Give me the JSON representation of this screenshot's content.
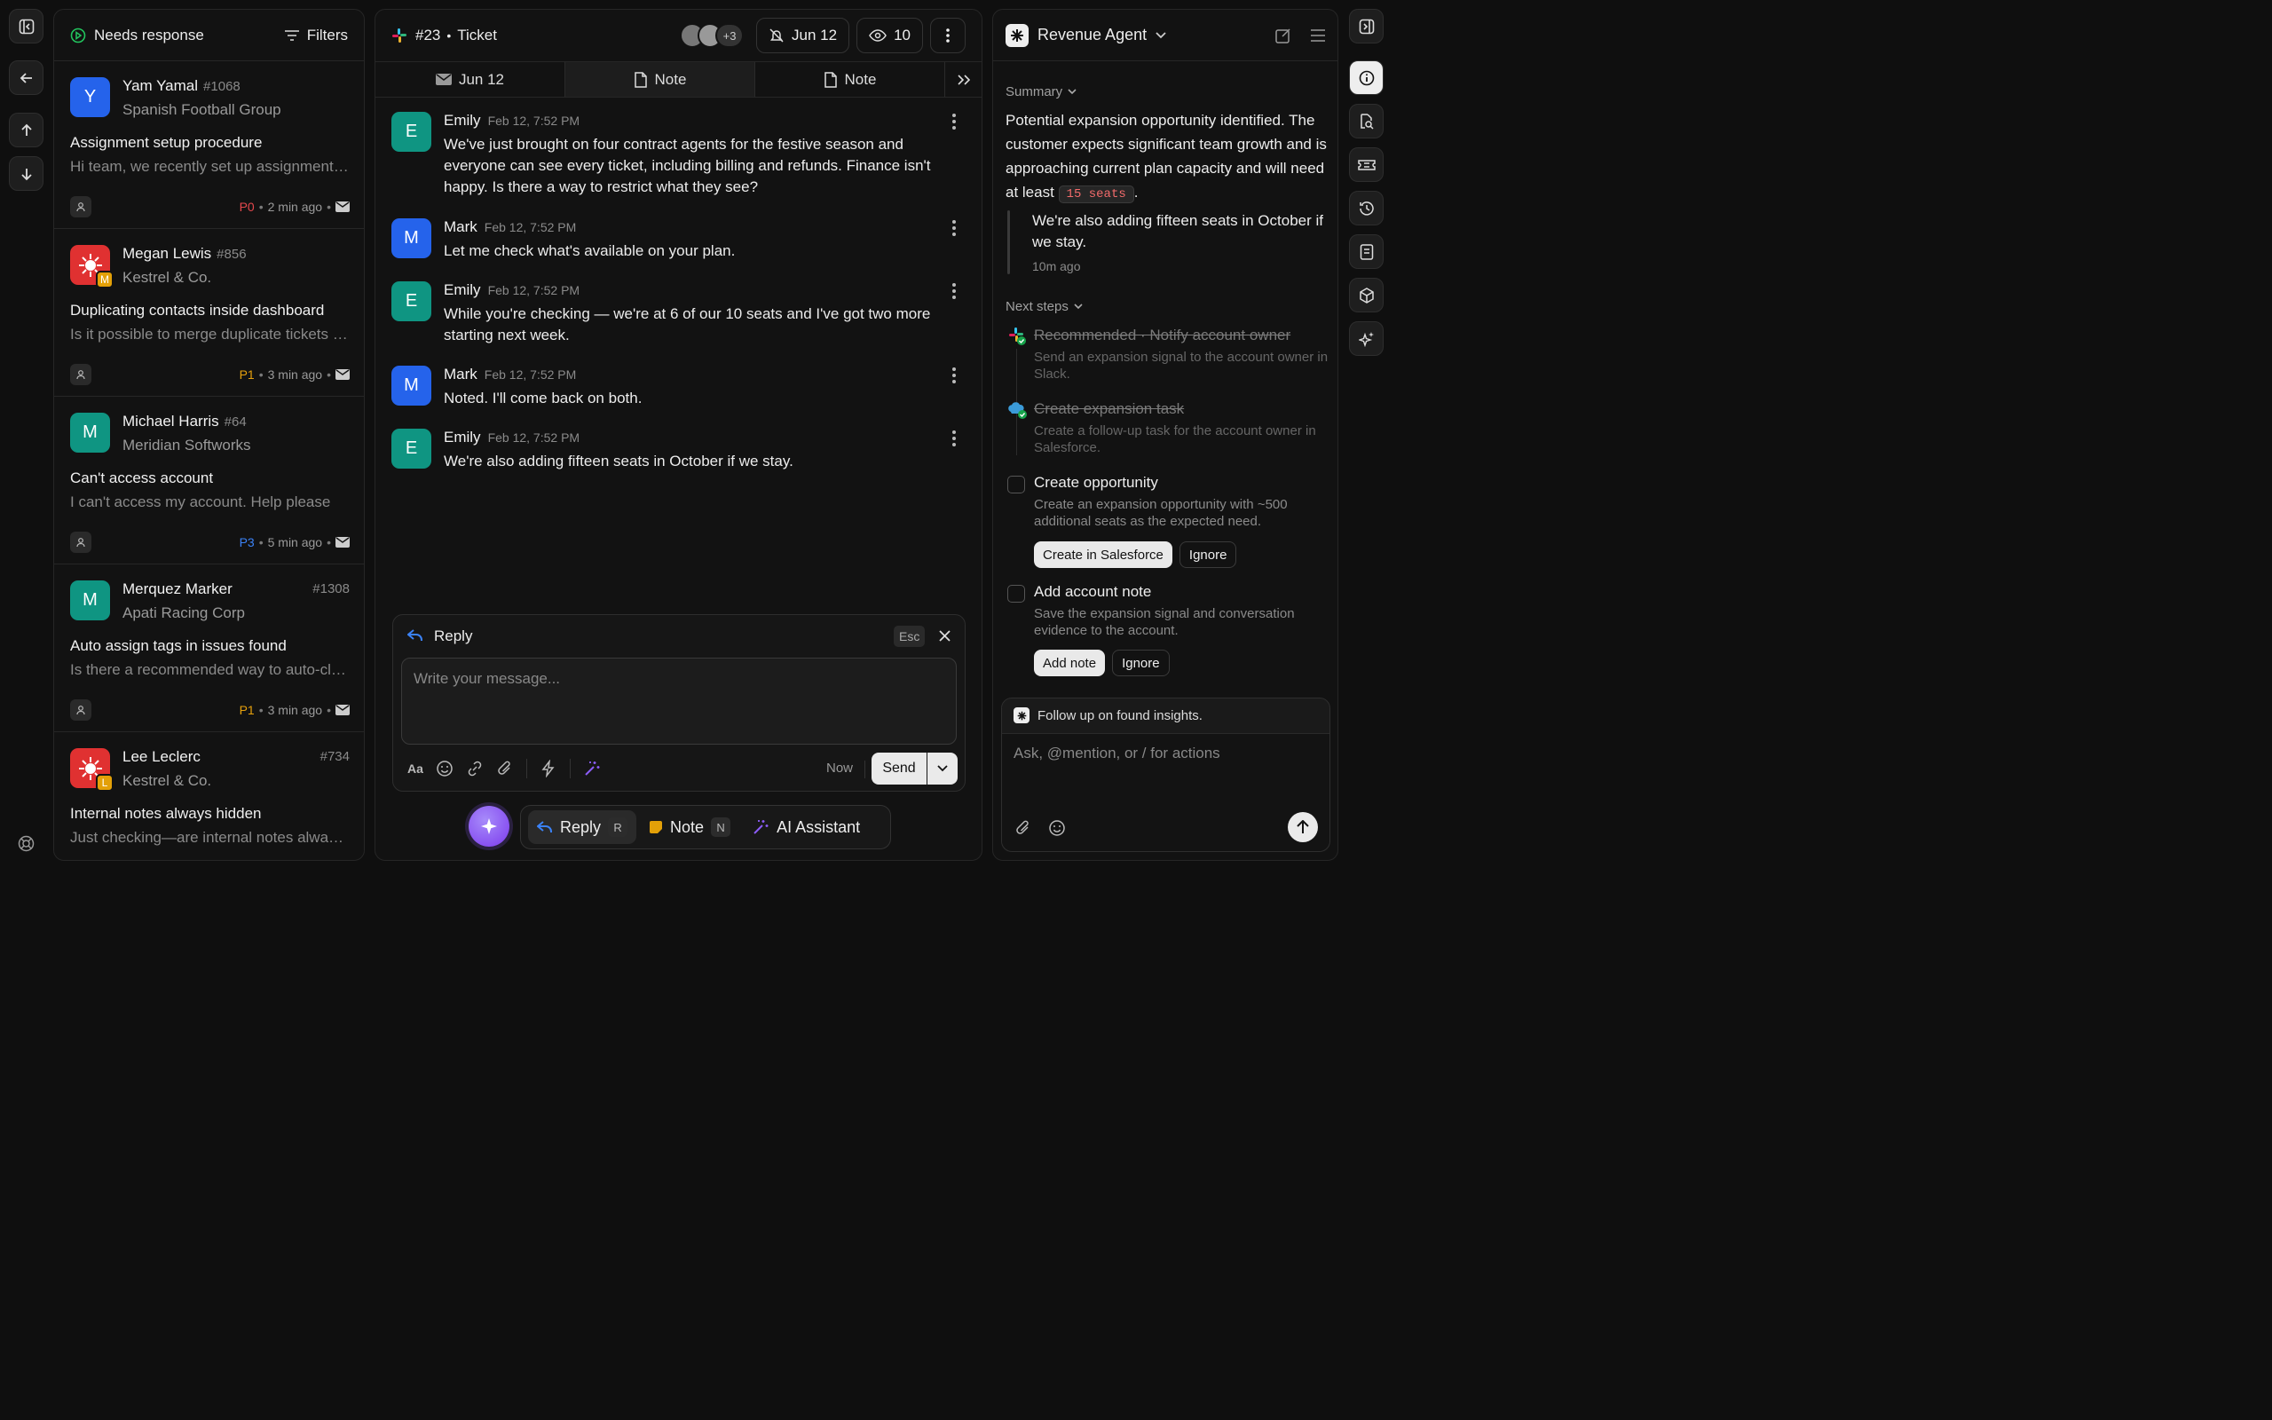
{
  "inbox": {
    "title": "Needs response",
    "filters_label": "Filters",
    "cards": [
      {
        "initial": "Y",
        "name": "Yam Yamal",
        "number": "#1068",
        "org": "Spanish Football Group",
        "subject": "Assignment setup procedure",
        "preview": "Hi team, we recently set up assignment rules for our team",
        "priority": "P0",
        "time": "2 min ago"
      },
      {
        "initial": "M",
        "name": "Megan Lewis",
        "number": "#856",
        "org": "Kestrel & Co.",
        "subject": "Duplicating contacts inside dashboard",
        "preview": "Is it possible to merge duplicate tickets from one contact",
        "priority": "P1",
        "time": "3 min ago",
        "badge": "M"
      },
      {
        "initial": "M",
        "name": "Michael Harris",
        "number": "#64",
        "org": "Meridian Softworks",
        "subject": "Can't access account",
        "preview": "I can't access my account. Help please",
        "priority": "P3",
        "time": "5 min ago"
      },
      {
        "initial": "M",
        "name": "Merquez Marker",
        "number": "#1308",
        "org": "Apati Racing Corp",
        "subject": "Auto assign tags in issues found",
        "preview": "Is there a recommended way to auto-classify issues",
        "priority": "P1",
        "time": "3 min ago"
      },
      {
        "initial": "L",
        "name": "Lee Leclerc",
        "number": "#734",
        "org": "Kestrel & Co.",
        "subject": "Internal notes always hidden",
        "preview": "Just checking—are internal notes always hidden from customers",
        "badge": "L"
      }
    ]
  },
  "ticket": {
    "number": "#23",
    "separator": "•",
    "title": "Ticket",
    "avatar_more": "+3",
    "snooze_date": "Jun 12",
    "viewers": "10",
    "tabs": [
      "Jun 12",
      "Note",
      "Note"
    ],
    "messages": [
      {
        "initial": "E",
        "author": "Emily",
        "time": "Feb 12, 7:52 PM",
        "text": "We've just brought on four contract agents for the festive season and everyone can see every ticket, including billing and refunds. Finance isn't happy. Is there a way to restrict what they see?"
      },
      {
        "initial": "M",
        "author": "Mark",
        "time": "Feb 12, 7:52 PM",
        "text": "Let me check what's available on your plan."
      },
      {
        "initial": "E",
        "author": "Emily",
        "time": "Feb 12, 7:52 PM",
        "text": "While you're checking — we're at 6 of our 10 seats and I've got two more starting next week."
      },
      {
        "initial": "M",
        "author": "Mark",
        "time": "Feb 12, 7:52 PM",
        "text": "Noted. I'll come back on both."
      },
      {
        "initial": "E",
        "author": "Emily",
        "time": "Feb 12, 7:52 PM",
        "text": "We're also adding fifteen seats in October if we stay."
      }
    ],
    "reply": {
      "title": "Reply",
      "esc": "Esc",
      "placeholder": "Write your message...",
      "now": "Now",
      "send": "Send"
    },
    "bottom": {
      "reply": "Reply",
      "reply_key": "R",
      "note": "Note",
      "note_key": "N",
      "ai": "AI Assistant"
    }
  },
  "agent": {
    "name": "Revenue Agent",
    "summary_label": "Summary",
    "summary_text": "Potential expansion opportunity identified. The customer expects significant team growth and is approaching current plan capacity and will need at least",
    "summary_code": "15 seats",
    "summary_end": ".",
    "quote": "We're also adding fifteen seats in October if we stay.",
    "quote_time": "10m ago",
    "next_label": "Next steps",
    "steps": [
      {
        "title": "Recommended · Notify account owner",
        "desc": "Send an expansion signal to the account owner in Slack."
      },
      {
        "title": "Create expansion task",
        "desc": "Create a follow-up task for the account owner in Salesforce."
      },
      {
        "title": "Create opportunity",
        "desc": "Create an expansion opportunity with ~500 additional seats as the expected need.",
        "primary": "Create in Salesforce",
        "secondary": "Ignore"
      },
      {
        "title": "Add account note",
        "desc": "Save the expansion signal and conversation evidence to the account.",
        "primary": "Add note",
        "secondary": "Ignore"
      }
    ],
    "chat_hint": "Follow up on found insights.",
    "chat_placeholder": "Ask, @mention, or / for actions"
  },
  "colors": {
    "blue": "#2563eb",
    "teal": "#0f9582",
    "red": "#e03131",
    "orange": "#e3a008",
    "p0": "#e5484d",
    "p1": "#e5a00d",
    "p3": "#3b82f6",
    "accent": "#8b5cf6"
  }
}
